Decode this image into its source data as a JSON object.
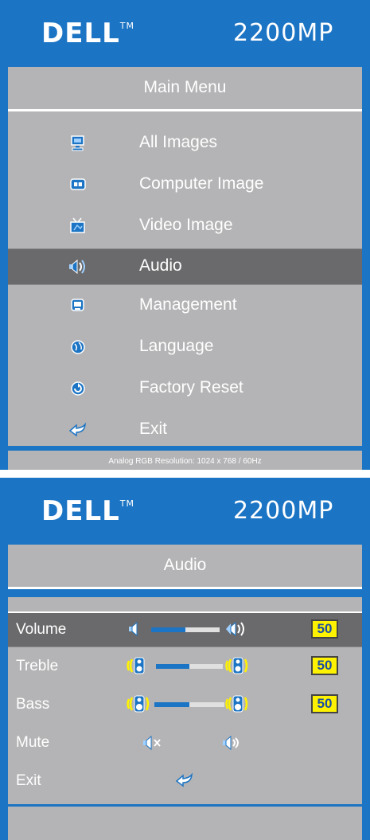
{
  "main_menu": {
    "brand": "DELL",
    "trademark": "TM",
    "model": "2200MP",
    "title": "Main Menu",
    "items": [
      {
        "label": "All Images",
        "icon": "monitor-icon"
      },
      {
        "label": "Computer Image",
        "icon": "computer-image-icon"
      },
      {
        "label": "Video Image",
        "icon": "video-image-icon"
      },
      {
        "label": "Audio",
        "icon": "audio-speaker-icon",
        "selected": true
      },
      {
        "label": "Management",
        "icon": "management-icon"
      },
      {
        "label": "Language",
        "icon": "globe-icon"
      },
      {
        "label": "Factory Reset",
        "icon": "factory-reset-icon"
      },
      {
        "label": "Exit",
        "icon": "exit-arrow-icon"
      }
    ],
    "footer": "Analog RGB Resolution: 1024 x 768 / 60Hz"
  },
  "audio_menu": {
    "brand": "DELL",
    "trademark": "TM",
    "model": "2200MP",
    "title": "Audio",
    "rows": [
      {
        "label": "Volume",
        "value": "50",
        "level": 0.5,
        "selected": true
      },
      {
        "label": "Treble",
        "value": "50",
        "level": 0.5
      },
      {
        "label": "Bass",
        "value": "50",
        "level": 0.5
      },
      {
        "label": "Mute"
      },
      {
        "label": "Exit"
      }
    ]
  },
  "colors": {
    "accent_blue": "#1c74c4",
    "panel_gray": "#b4b4b6",
    "selected_gray": "#6a6a6c",
    "value_yellow": "#fff200"
  }
}
